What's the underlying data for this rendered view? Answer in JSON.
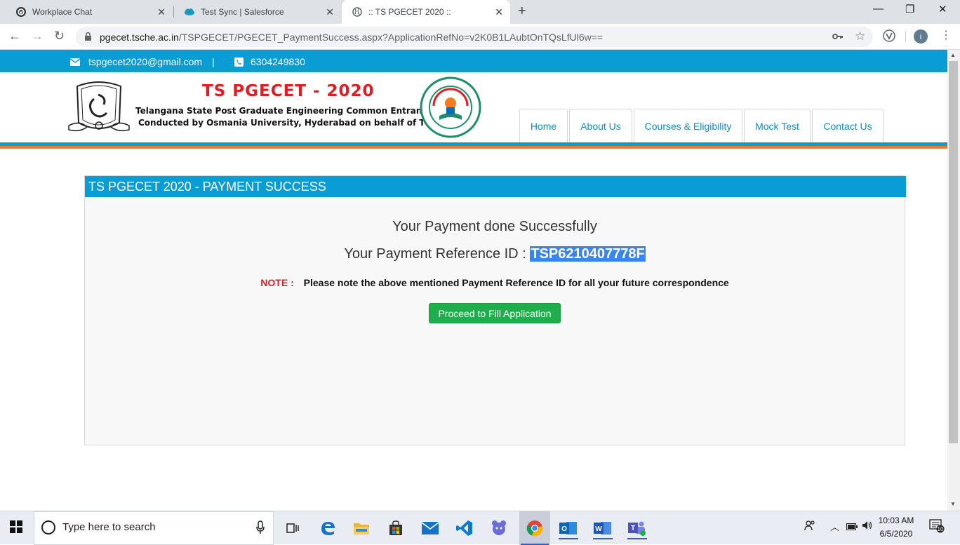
{
  "browser": {
    "tabs": [
      {
        "title": "Workplace Chat",
        "icon": "workplace-icon"
      },
      {
        "title": "Test Sync | Salesforce",
        "icon": "salesforce-icon"
      },
      {
        "title": ":: TS PGECET 2020 ::",
        "icon": "globe-icon"
      }
    ],
    "url_host": "pgecet.tsche.ac.in",
    "url_path": "/TSPGECET/PGECET_PaymentSuccess.aspx?ApplicationRefNo=v2K0B1LAubtOnTQsLfUl6w=="
  },
  "topbar": {
    "email": "tspgecet2020@gmail.com",
    "separator": "|",
    "phone": "6304249830"
  },
  "header": {
    "title": "TS PGECET - 2020",
    "subtitle1": "Telangana State Post Graduate Engineering Common Entrance Test",
    "subtitle2": "Conducted by Osmania University, Hyderabad on behalf of TSCHE",
    "logo_left_text": "OSMANIA UNIVERSITY",
    "logo_right_text": "TELANGANA STATE COUNCIL OF HIGHER EDUCATION"
  },
  "nav": {
    "items": [
      "Home",
      "About Us",
      "Courses & Eligibility",
      "Mock Test",
      "Contact Us"
    ]
  },
  "panel": {
    "heading": "TS PGECET 2020 - PAYMENT SUCCESS",
    "message": "Your Payment done Successfully",
    "ref_label": "Your Payment Reference ID :",
    "ref_id": "TSP6210407778F",
    "note_label": "NOTE :",
    "note_text": "Please note the above mentioned Payment Reference ID for all your future correspondence",
    "button_label": "Proceed to Fill Application"
  },
  "taskbar": {
    "search_placeholder": "Type here to search",
    "time": "10:03 AM",
    "date": "6/5/2020",
    "notification_count": "10"
  },
  "colors": {
    "brand_blue": "#0a9cd5",
    "brand_orange": "#f47b20",
    "title_red": "#e31b23",
    "success_green": "#1fae4b"
  }
}
